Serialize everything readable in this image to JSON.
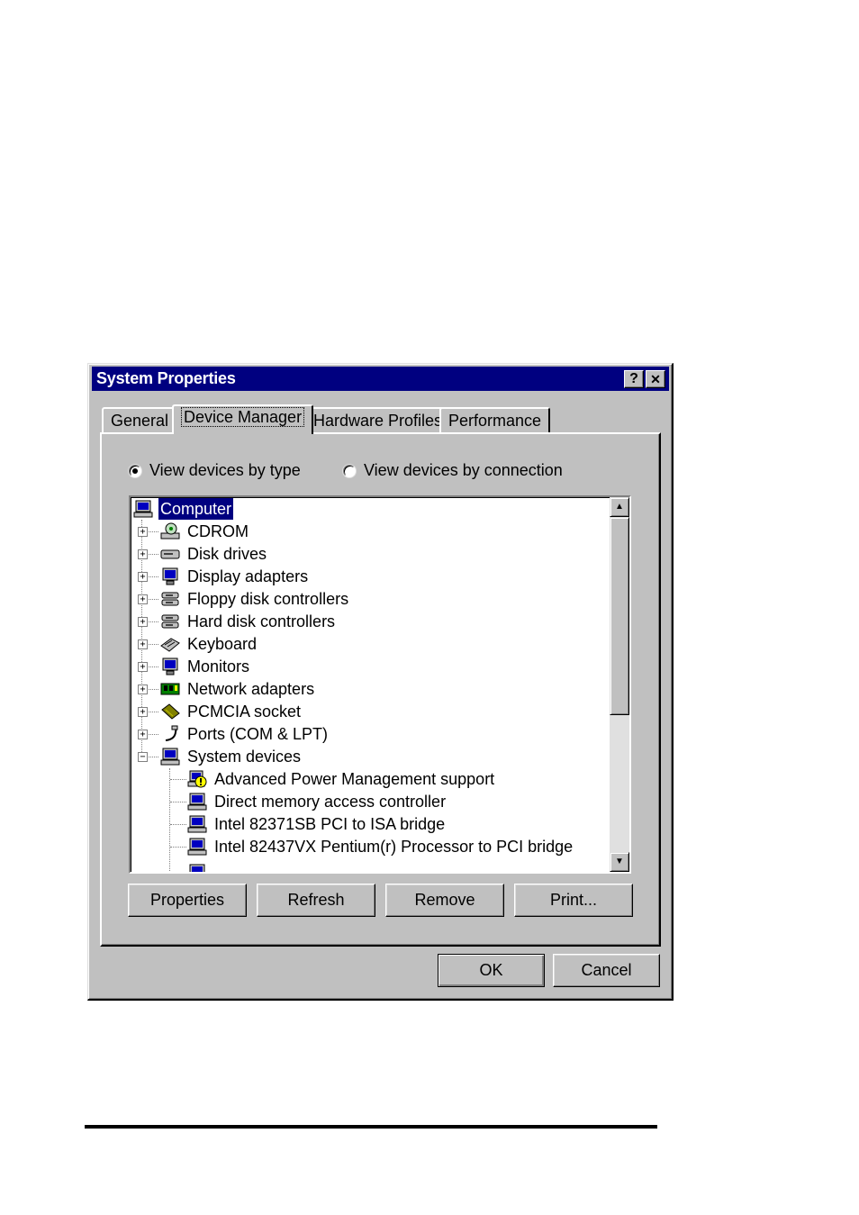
{
  "window": {
    "title": "System Properties",
    "help_button": "?",
    "close_button": "✕"
  },
  "tabs": [
    {
      "label": "General",
      "active": false
    },
    {
      "label": "Device Manager",
      "active": true
    },
    {
      "label": "Hardware Profiles",
      "active": false
    },
    {
      "label": "Performance",
      "active": false
    }
  ],
  "view_options": {
    "by_type": {
      "label": "View devices by type",
      "selected": true
    },
    "by_connection": {
      "label": "View devices by connection",
      "selected": false
    }
  },
  "tree": {
    "root": {
      "label": "Computer",
      "icon": "computer-icon",
      "selected": true
    },
    "items": [
      {
        "label": "CDROM",
        "icon": "cdrom-icon",
        "expander": "+"
      },
      {
        "label": "Disk drives",
        "icon": "disk-drive-icon",
        "expander": "+"
      },
      {
        "label": "Display adapters",
        "icon": "monitor-icon",
        "expander": "+"
      },
      {
        "label": "Floppy disk controllers",
        "icon": "controller-icon",
        "expander": "+"
      },
      {
        "label": "Hard disk controllers",
        "icon": "controller-icon",
        "expander": "+"
      },
      {
        "label": "Keyboard",
        "icon": "keyboard-icon",
        "expander": "+"
      },
      {
        "label": "Monitors",
        "icon": "monitor-icon",
        "expander": "+"
      },
      {
        "label": "Network adapters",
        "icon": "network-card-icon",
        "expander": "+"
      },
      {
        "label": "PCMCIA socket",
        "icon": "pcmcia-icon",
        "expander": "+"
      },
      {
        "label": "Ports (COM & LPT)",
        "icon": "port-icon",
        "expander": "+"
      },
      {
        "label": "System devices",
        "icon": "computer-icon",
        "expander": "−"
      }
    ],
    "children": [
      {
        "label": "Advanced Power Management support",
        "icon": "warning-device-icon"
      },
      {
        "label": "Direct memory access controller",
        "icon": "computer-icon"
      },
      {
        "label": "Intel 82371SB PCI to ISA bridge",
        "icon": "computer-icon"
      },
      {
        "label": "Intel 82437VX Pentium(r) Processor to PCI bridge",
        "icon": "computer-icon"
      }
    ]
  },
  "actions": {
    "properties": "Properties",
    "refresh": "Refresh",
    "remove": "Remove",
    "print": "Print..."
  },
  "dialog_buttons": {
    "ok": "OK",
    "cancel": "Cancel"
  },
  "colors": {
    "titlebar": "#000080",
    "face": "#c0c0c0",
    "selection": "#000080"
  }
}
